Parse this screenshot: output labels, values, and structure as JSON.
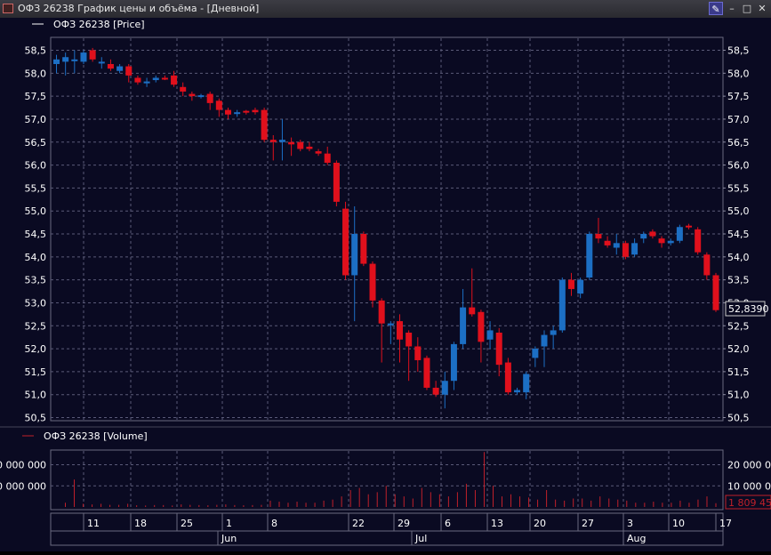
{
  "window": {
    "title": "ОФЗ 26238 График цены и объёма - [Дневной]",
    "icons": [
      "chart-app-icon",
      "pin-icon",
      "minimize-icon",
      "maximize-icon",
      "close-icon"
    ]
  },
  "colors": {
    "background": "#0a0a22",
    "grid": "#5a5a78",
    "up": "#1c6fc4",
    "down": "#e0101c",
    "text": "#ffffff",
    "volume": "#c0202a"
  },
  "chart_data": [
    {
      "type": "candlestick",
      "legend": "ОФЗ 26238 [Price]",
      "ylim": [
        50.5,
        58.5
      ],
      "yticks": [
        "58,5",
        "58,0",
        "57,5",
        "57,0",
        "56,5",
        "56,0",
        "55,5",
        "55,0",
        "54,5",
        "54,0",
        "53,5",
        "53,0",
        "52,5",
        "52,0",
        "51,5",
        "51,0",
        "50,5"
      ],
      "last_price_label": "52,8390",
      "grid": true,
      "candles": [
        {
          "o": 58.2,
          "c": 58.3,
          "h": 58.4,
          "l": 58.0
        },
        {
          "o": 58.25,
          "c": 58.35,
          "h": 58.45,
          "l": 57.95
        },
        {
          "o": 58.3,
          "c": 58.3,
          "h": 58.5,
          "l": 58.0
        },
        {
          "o": 58.25,
          "c": 58.45,
          "h": 58.5,
          "l": 58.2
        },
        {
          "o": 58.5,
          "c": 58.3,
          "h": 58.55,
          "l": 58.25
        },
        {
          "o": 58.25,
          "c": 58.25,
          "h": 58.35,
          "l": 58.1
        },
        {
          "o": 58.2,
          "c": 58.1,
          "h": 58.3,
          "l": 58.05
        },
        {
          "o": 58.05,
          "c": 58.15,
          "h": 58.2,
          "l": 58.0
        },
        {
          "o": 58.15,
          "c": 57.95,
          "h": 58.2,
          "l": 57.8
        },
        {
          "o": 57.9,
          "c": 57.8,
          "h": 57.95,
          "l": 57.75
        },
        {
          "o": 57.78,
          "c": 57.82,
          "h": 57.9,
          "l": 57.7
        },
        {
          "o": 57.85,
          "c": 57.9,
          "h": 57.95,
          "l": 57.8
        },
        {
          "o": 57.9,
          "c": 57.88,
          "h": 57.95,
          "l": 57.85
        },
        {
          "o": 57.95,
          "c": 57.75,
          "h": 58.05,
          "l": 57.7
        },
        {
          "o": 57.7,
          "c": 57.6,
          "h": 57.8,
          "l": 57.5
        },
        {
          "o": 57.55,
          "c": 57.5,
          "h": 57.6,
          "l": 57.4
        },
        {
          "o": 57.5,
          "c": 57.52,
          "h": 57.55,
          "l": 57.45
        },
        {
          "o": 57.55,
          "c": 57.35,
          "h": 57.6,
          "l": 57.2
        },
        {
          "o": 57.4,
          "c": 57.2,
          "h": 57.45,
          "l": 57.05
        },
        {
          "o": 57.2,
          "c": 57.1,
          "h": 57.25,
          "l": 57.0
        },
        {
          "o": 57.12,
          "c": 57.15,
          "h": 57.2,
          "l": 57.05
        },
        {
          "o": 57.18,
          "c": 57.15,
          "h": 57.2,
          "l": 57.1
        },
        {
          "o": 57.2,
          "c": 57.15,
          "h": 57.25,
          "l": 57.1
        },
        {
          "o": 57.2,
          "c": 56.55,
          "h": 57.25,
          "l": 56.5
        },
        {
          "o": 56.55,
          "c": 56.5,
          "h": 56.65,
          "l": 56.1
        },
        {
          "o": 56.5,
          "c": 56.55,
          "h": 57.0,
          "l": 56.1
        },
        {
          "o": 56.5,
          "c": 56.45,
          "h": 56.6,
          "l": 56.2
        },
        {
          "o": 56.5,
          "c": 56.35,
          "h": 56.55,
          "l": 56.3
        },
        {
          "o": 56.4,
          "c": 56.35,
          "h": 56.5,
          "l": 56.3
        },
        {
          "o": 56.3,
          "c": 56.25,
          "h": 56.35,
          "l": 56.2
        },
        {
          "o": 56.25,
          "c": 56.05,
          "h": 56.4,
          "l": 56.0
        },
        {
          "o": 56.05,
          "c": 55.2,
          "h": 56.1,
          "l": 55.1
        },
        {
          "o": 55.05,
          "c": 53.6,
          "h": 55.2,
          "l": 53.5
        },
        {
          "o": 53.6,
          "c": 54.5,
          "h": 55.1,
          "l": 52.6
        },
        {
          "o": 54.5,
          "c": 53.85,
          "h": 54.55,
          "l": 53.8
        },
        {
          "o": 53.85,
          "c": 53.05,
          "h": 53.9,
          "l": 52.9
        },
        {
          "o": 53.05,
          "c": 52.55,
          "h": 53.1,
          "l": 51.7
        },
        {
          "o": 52.55,
          "c": 52.55,
          "h": 52.6,
          "l": 52.1
        },
        {
          "o": 52.6,
          "c": 52.2,
          "h": 52.75,
          "l": 51.7
        },
        {
          "o": 52.35,
          "c": 52.05,
          "h": 52.4,
          "l": 51.3
        },
        {
          "o": 52.05,
          "c": 51.75,
          "h": 52.25,
          "l": 51.5
        },
        {
          "o": 51.8,
          "c": 51.15,
          "h": 51.85,
          "l": 51.1
        },
        {
          "o": 51.15,
          "c": 51.0,
          "h": 51.3,
          "l": 50.95
        },
        {
          "o": 51.0,
          "c": 51.3,
          "h": 51.5,
          "l": 50.7
        },
        {
          "o": 51.3,
          "c": 52.1,
          "h": 52.15,
          "l": 51.1
        },
        {
          "o": 52.1,
          "c": 52.9,
          "h": 53.3,
          "l": 52.0
        },
        {
          "o": 52.9,
          "c": 52.75,
          "h": 53.75,
          "l": 52.7
        },
        {
          "o": 52.8,
          "c": 52.15,
          "h": 52.85,
          "l": 51.7
        },
        {
          "o": 52.2,
          "c": 52.4,
          "h": 52.6,
          "l": 52.0
        },
        {
          "o": 52.35,
          "c": 51.65,
          "h": 52.45,
          "l": 51.4
        },
        {
          "o": 51.7,
          "c": 51.05,
          "h": 51.8,
          "l": 51.0
        },
        {
          "o": 51.05,
          "c": 51.1,
          "h": 51.15,
          "l": 51.0
        },
        {
          "o": 51.05,
          "c": 51.45,
          "h": 51.5,
          "l": 50.9
        },
        {
          "o": 51.8,
          "c": 52.0,
          "h": 52.05,
          "l": 51.6
        },
        {
          "o": 52.05,
          "c": 52.3,
          "h": 52.4,
          "l": 51.6
        },
        {
          "o": 52.3,
          "c": 52.4,
          "h": 52.5,
          "l": 52.0
        },
        {
          "o": 52.4,
          "c": 53.5,
          "h": 53.55,
          "l": 52.35
        },
        {
          "o": 53.5,
          "c": 53.3,
          "h": 53.65,
          "l": 53.15
        },
        {
          "o": 53.2,
          "c": 53.5,
          "h": 53.55,
          "l": 53.1
        },
        {
          "o": 53.55,
          "c": 54.5,
          "h": 54.55,
          "l": 53.5
        },
        {
          "o": 54.5,
          "c": 54.4,
          "h": 54.85,
          "l": 54.3
        },
        {
          "o": 54.35,
          "c": 54.25,
          "h": 54.45,
          "l": 54.2
        },
        {
          "o": 54.2,
          "c": 54.3,
          "h": 54.5,
          "l": 54.05
        },
        {
          "o": 54.3,
          "c": 54.0,
          "h": 54.35,
          "l": 53.95
        },
        {
          "o": 54.05,
          "c": 54.3,
          "h": 54.4,
          "l": 54.0
        },
        {
          "o": 54.4,
          "c": 54.5,
          "h": 54.55,
          "l": 54.3
        },
        {
          "o": 54.55,
          "c": 54.45,
          "h": 54.6,
          "l": 54.4
        },
        {
          "o": 54.4,
          "c": 54.3,
          "h": 54.45,
          "l": 54.2
        },
        {
          "o": 54.3,
          "c": 54.35,
          "h": 54.4,
          "l": 54.25
        },
        {
          "o": 54.35,
          "c": 54.65,
          "h": 54.7,
          "l": 54.3
        },
        {
          "o": 54.68,
          "c": 54.65,
          "h": 54.72,
          "l": 54.6
        },
        {
          "o": 54.6,
          "c": 54.1,
          "h": 54.65,
          "l": 54.05
        },
        {
          "o": 54.05,
          "c": 53.6,
          "h": 54.1,
          "l": 53.5
        },
        {
          "o": 53.6,
          "c": 52.84,
          "h": 53.65,
          "l": 52.8
        }
      ]
    },
    {
      "type": "bar",
      "legend": "ОФЗ 26238 [Volume]",
      "ylim": [
        0,
        25000000
      ],
      "yticks": [
        "20 000 000",
        "10 000 000"
      ],
      "last_value_label": "1 809 453",
      "values": [
        2000000,
        13000000,
        1500000,
        1200000,
        1500000,
        1000000,
        1000000,
        1500000,
        800000,
        700000,
        900000,
        900000,
        700000,
        1200000,
        1000000,
        900000,
        800000,
        1000000,
        1200000,
        900000,
        800000,
        900000,
        1000000,
        3000000,
        2500000,
        2000000,
        2500000,
        2000000,
        2000000,
        3000000,
        3500000,
        5000000,
        8000000,
        9000000,
        6000000,
        7000000,
        10000000,
        6000000,
        5000000,
        4000000,
        9000000,
        7000000,
        6000000,
        5000000,
        7000000,
        11000000,
        8000000,
        26000000,
        10000000,
        5000000,
        6000000,
        5000000,
        4500000,
        3500000,
        8000000,
        3500000,
        3000000,
        4000000,
        4000000,
        3000000,
        5000000,
        4000000,
        3500000,
        3000000,
        2000000,
        2000000,
        2500000,
        2000000,
        2000000,
        3000000,
        2000000,
        3500000,
        5000000,
        1809453
      ]
    }
  ],
  "time_axis": {
    "day_labels": [
      "11",
      "18",
      "25",
      "1",
      "8",
      "22",
      "29",
      "6",
      "13",
      "20",
      "27",
      "3",
      "10",
      "17"
    ],
    "month_labels": [
      "Jun",
      "Jul",
      "Aug"
    ]
  }
}
